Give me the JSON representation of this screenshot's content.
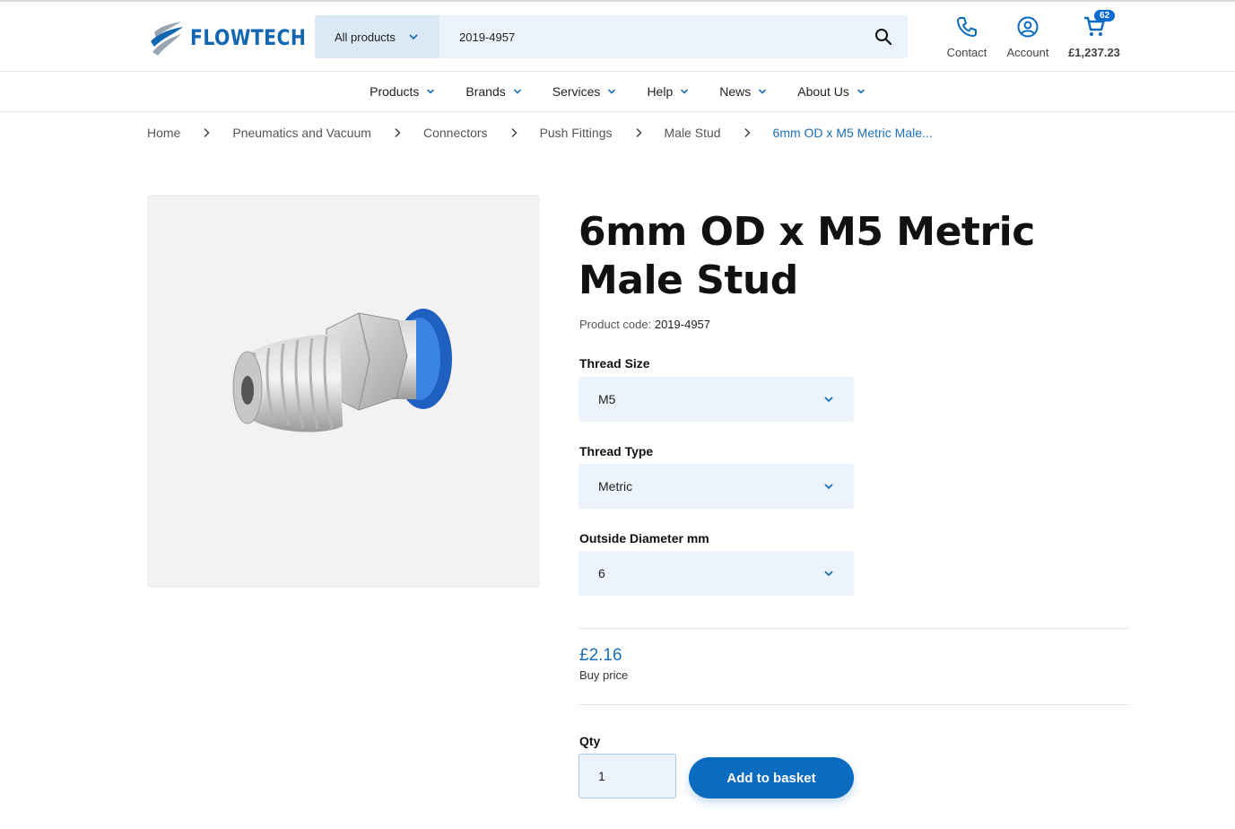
{
  "brand": {
    "name": "FLOWTECH",
    "color": "#1366b0"
  },
  "search": {
    "category": "All products",
    "query": "2019-4957"
  },
  "header_actions": {
    "contact": "Contact",
    "account": "Account",
    "cart_count": "62",
    "cart_total": "£1,237.23"
  },
  "nav": [
    "Products",
    "Brands",
    "Services",
    "Help",
    "News",
    "About Us"
  ],
  "breadcrumb": [
    "Home",
    "Pneumatics and Vacuum",
    "Connectors",
    "Push Fittings",
    "Male Stud",
    "6mm OD x M5 Metric Male..."
  ],
  "product": {
    "title": "6mm OD x M5 Metric Male Stud",
    "code_label": "Product code:",
    "code": "2019-4957",
    "options": [
      {
        "label": "Thread Size",
        "value": "M5"
      },
      {
        "label": "Thread Type",
        "value": "Metric"
      },
      {
        "label": "Outside Diameter mm",
        "value": "6"
      }
    ],
    "price": "£2.16",
    "price_label": "Buy price",
    "qty_label": "Qty",
    "qty": "1",
    "add_button": "Add to basket"
  },
  "icons": {
    "search": "search-icon",
    "phone": "phone-icon",
    "account": "account-icon",
    "cart": "cart-icon",
    "chevron": "chevron-down-icon"
  },
  "colors": {
    "accent": "#0b6bbf",
    "field_bg": "#ecf3fb",
    "link": "#1a6fb6"
  }
}
